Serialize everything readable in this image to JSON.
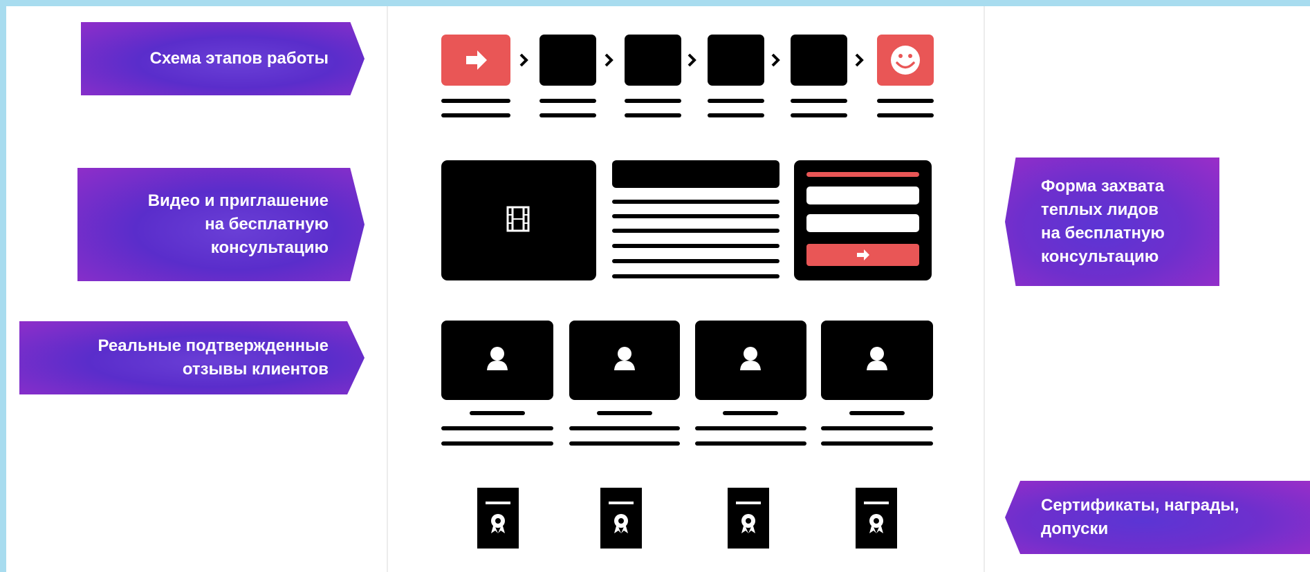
{
  "labels": {
    "stages": "Схема этапов работы",
    "video": "Видео и приглашение\nна бесплатную\nконсультацию",
    "reviews": "Реальные подтвержденные\nотзывы клиентов",
    "lead_form": "Форма захвата\nтеплых лидов\nна бесплатную\nконсультацию",
    "certificates": "Сертификаты, награды,\nдопуски"
  },
  "colors": {
    "accent_red": "#e95656",
    "block": "#000000",
    "label_purple": "#6a3fd6",
    "frame_blue": "#a8dcef"
  },
  "icons": {
    "first_step": "arrow-right-icon",
    "last_step": "smiley-icon",
    "video": "film-icon",
    "review": "person-icon",
    "certificate": "award-icon",
    "form_submit": "arrow-right-icon"
  }
}
